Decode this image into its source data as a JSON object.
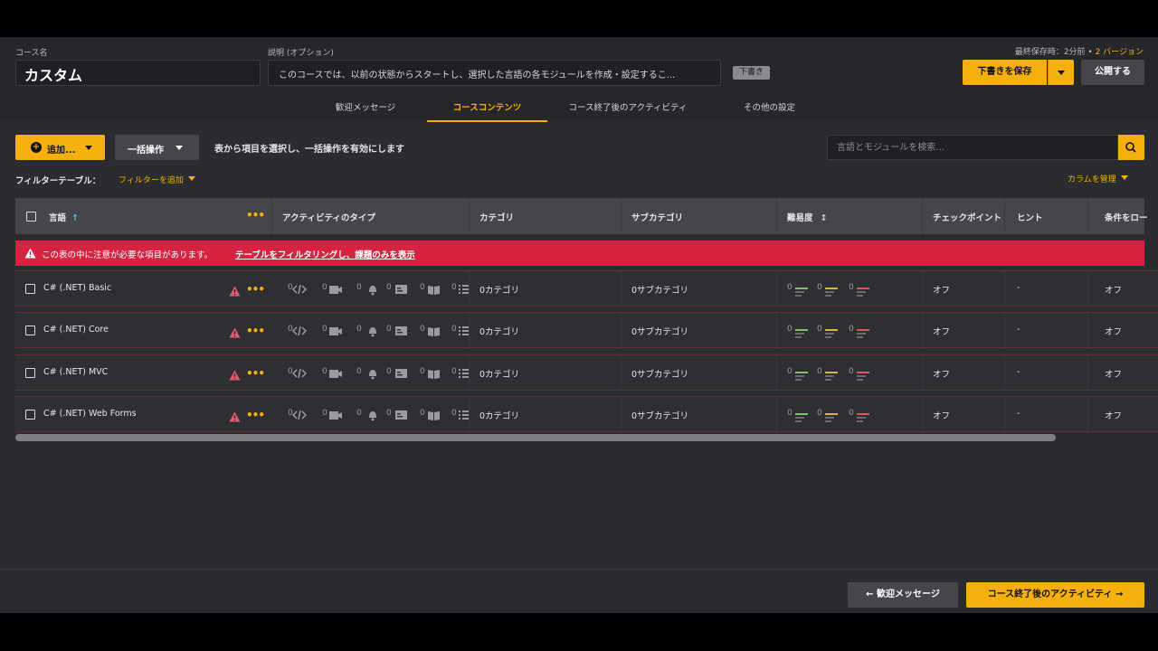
{
  "header": {
    "course_name_label": "コース名",
    "course_name_value": "カスタム",
    "description_label": "説明 (オプション)",
    "description_value": "このコースでは、以前の状態からスタートし、選択した言語の各モジュールを作成・設定するこ...",
    "draft_badge": "下書き",
    "last_saved_text": "最終保存時：2分前 • ",
    "version_text": "2 バージョン",
    "save_draft_button": "下書きを保存",
    "publish_button": "公開する"
  },
  "tabs": [
    {
      "label": "歓迎メッセージ",
      "active": false
    },
    {
      "label": "コースコンテンツ",
      "active": true
    },
    {
      "label": "コース終了後のアクティビティ",
      "active": false
    },
    {
      "label": "その他の設定",
      "active": false
    }
  ],
  "toolbar": {
    "add_button": "追加...",
    "bulk_button": "一括操作",
    "bulk_hint": "表から項目を選択し、一括操作を有効にします",
    "search_placeholder": "言語とモジュールを検索...",
    "filter_label": "フィルターテーブル：",
    "filter_add": "フィルターを追加",
    "manage_columns": "カラムを管理"
  },
  "table": {
    "columns": [
      "言語",
      "アクティビティのタイプ",
      "カテゴリ",
      "サブカテゴリ",
      "難易度",
      "チェックポイント",
      "ヒント",
      "条件をロー"
    ],
    "alert_text": "この表の中に注意が必要な項目があります。",
    "alert_link": "テーブルをフィルタリングし、課題のみを表示",
    "rows": [
      {
        "name": "C# (.NET) Basic",
        "counts": [
          "0",
          "0",
          "0",
          "0",
          "0",
          "0"
        ],
        "category": "0カテゴリ",
        "subcategory": "0サブカテゴリ",
        "difficulty": [
          "0",
          "0",
          "0"
        ],
        "checkpoint": "オフ",
        "hint": "-",
        "condition": "オフ"
      },
      {
        "name": "C# (.NET) Core",
        "counts": [
          "0",
          "0",
          "0",
          "0",
          "0",
          "0"
        ],
        "category": "0カテゴリ",
        "subcategory": "0サブカテゴリ",
        "difficulty": [
          "0",
          "0",
          "0"
        ],
        "checkpoint": "オフ",
        "hint": "-",
        "condition": "オフ"
      },
      {
        "name": "C# (.NET) MVC",
        "counts": [
          "0",
          "0",
          "0",
          "0",
          "0",
          "0"
        ],
        "category": "0カテゴリ",
        "subcategory": "0サブカテゴリ",
        "difficulty": [
          "0",
          "0",
          "0"
        ],
        "checkpoint": "オフ",
        "hint": "-",
        "condition": "オフ"
      },
      {
        "name": "C# (.NET) Web Forms",
        "counts": [
          "0",
          "0",
          "0",
          "0",
          "0",
          "0"
        ],
        "category": "0カテゴリ",
        "subcategory": "0サブカテゴリ",
        "difficulty": [
          "0",
          "0",
          "0"
        ],
        "checkpoint": "オフ",
        "hint": "-",
        "condition": "オフ"
      }
    ]
  },
  "footer": {
    "prev_button": "歓迎メッセージ",
    "next_button": "コース終了後のアクティビティ"
  },
  "colors": {
    "accent": "#f5b00e",
    "alert": "#d62341",
    "background": "#2b2c2f"
  }
}
